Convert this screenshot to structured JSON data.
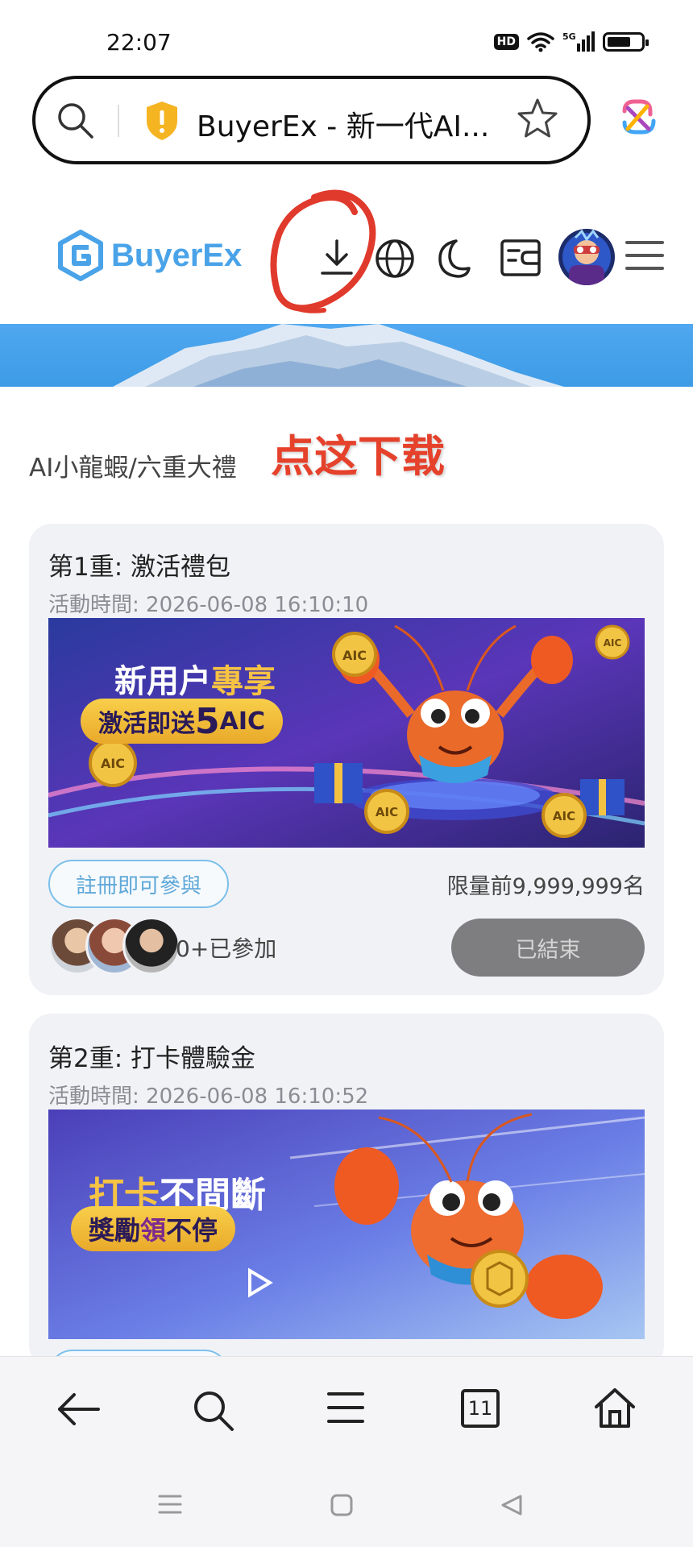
{
  "status_bar": {
    "time": "22:07",
    "hd": "HD",
    "network": "5G",
    "battery_level": 0.7
  },
  "browser": {
    "url_title": "BuyerEx - 新一代AI...",
    "icons": [
      "search-icon",
      "shield-icon",
      "star-icon",
      "extension-icon"
    ]
  },
  "site": {
    "logo_text": "BuyerEx",
    "header_icons": [
      "download-icon",
      "globe-icon",
      "moon-icon",
      "wallet-icon",
      "avatar",
      "menu-icon"
    ]
  },
  "section": {
    "title": "AI小龍蝦/六重大禮",
    "annotation": "点这下载"
  },
  "cards": [
    {
      "title": "第1重: 激活禮包",
      "time": "活動時間: 2026-06-08 16:10:10",
      "banner_line1_a": "新用户",
      "banner_line1_b": "專享",
      "banner_line2_a": "激活即送",
      "banner_line2_b": "5",
      "banner_line2_c": "AIC",
      "coin_label": "AIC",
      "join_label": "註冊即可參與",
      "limit": "限量前9,999,999名",
      "joined": "0+已參加",
      "status_button": "已結束"
    },
    {
      "title": "第2重: 打卡體驗金",
      "time": "活動時間: 2026-06-08 16:10:52",
      "banner_line1_a": "打卡",
      "banner_line1_b": "不間斷",
      "banner_line2_a": "獎勵",
      "banner_line2_b": "領",
      "banner_line2_c": "不停"
    }
  ],
  "bottom_nav": {
    "tab_count": "11",
    "icons": [
      "back-icon",
      "search-icon",
      "menu-icon",
      "tabs-icon",
      "home-icon"
    ]
  },
  "colors": {
    "brand": "#4aa3e8",
    "annotation": "#e5412b",
    "ended": "#7e7e80"
  }
}
